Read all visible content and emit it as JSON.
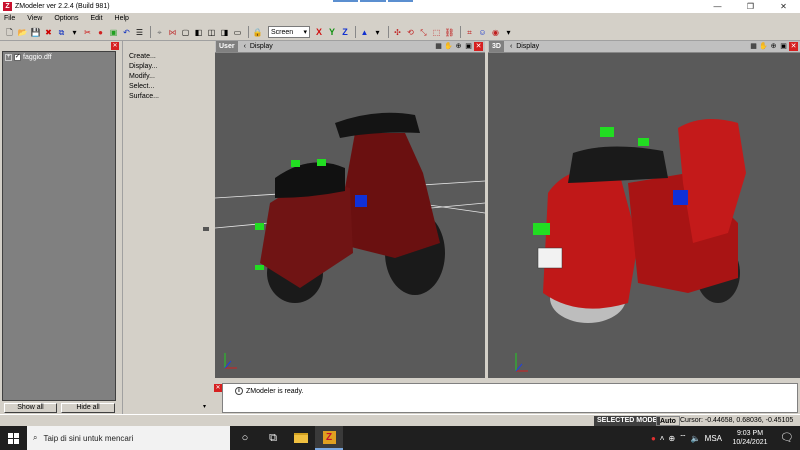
{
  "window": {
    "title": "ZModeler ver 2.2.4 (Build 981)",
    "logo": "Z",
    "controls": {
      "minimize": "—",
      "restore": "❐",
      "close": "✕"
    }
  },
  "menu": [
    "File",
    "View",
    "Options",
    "Edit",
    "Help"
  ],
  "toolbar": {
    "combo_value": "Screen",
    "axis_x": "X",
    "axis_y": "Y",
    "axis_z": "Z"
  },
  "left_panel": {
    "tree_item": "faggio.dff",
    "show_all": "Show all",
    "hide_all": "Hide all"
  },
  "commands": [
    "Create...",
    "Display...",
    "Modify...",
    "Select...",
    "Surface..."
  ],
  "viewport_left": {
    "label": "User",
    "menu": "Display"
  },
  "viewport_right": {
    "label": "3D",
    "menu": "Display"
  },
  "log": {
    "message": "ZModeler is ready."
  },
  "status": {
    "mode": "SELECTED MODE",
    "auto": "Auto",
    "cursor": "Cursor: -0.44658, 0.68036, -0.45105"
  },
  "taskbar": {
    "search_placeholder": "Taip di sini untuk mencari",
    "lang": "MSA",
    "time": "9:03 PM",
    "date": "10/24/2021"
  },
  "colors": {
    "accent_red": "#c8102e",
    "viewport_bg": "#5a5a5a",
    "select_green": "#22dd22",
    "pivot_blue": "#1030d8"
  }
}
